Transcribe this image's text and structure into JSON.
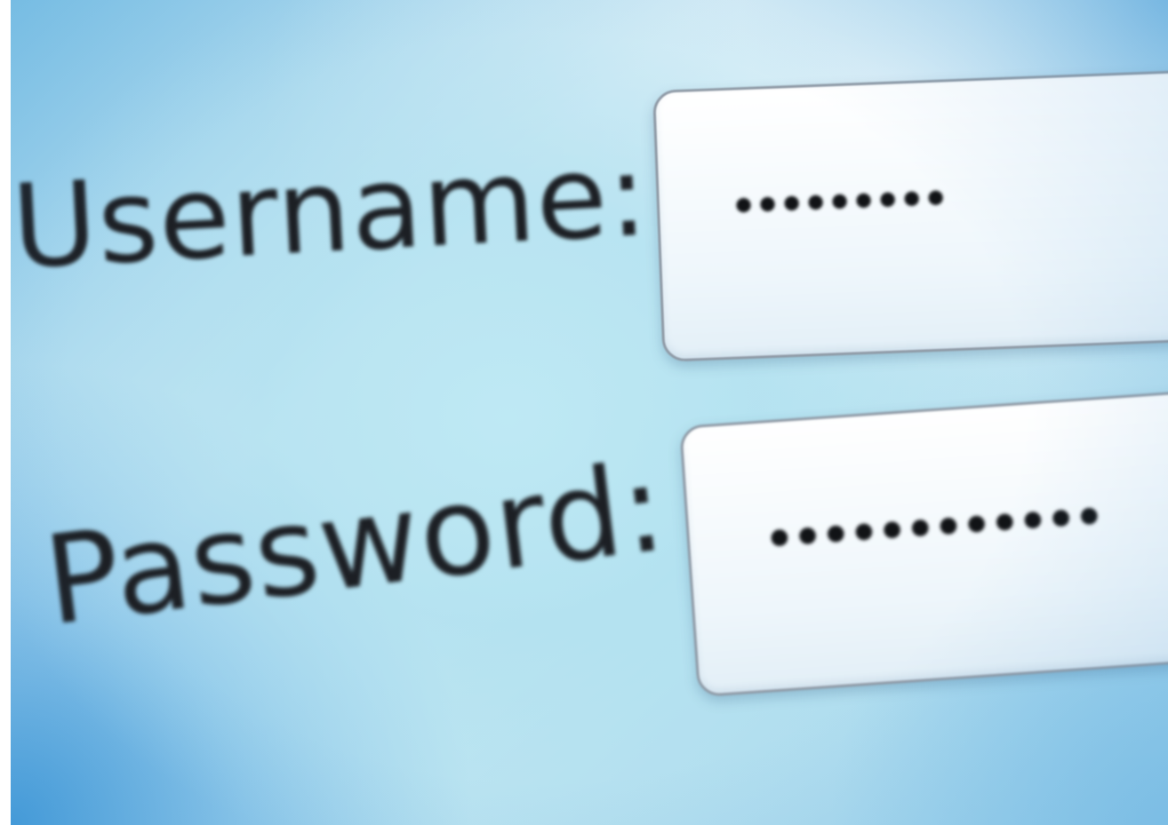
{
  "login_form": {
    "username": {
      "label": "Username:",
      "masked_value": "•••••••••",
      "field_type": "text-input"
    },
    "password": {
      "label": "Password:",
      "masked_value": "••••••••••••",
      "field_type": "password-input"
    }
  },
  "colors": {
    "background_light": "#cfe9f4",
    "background_accent": "#3f95d2",
    "field_background": "#ffffff",
    "field_border": "#8f9aa6",
    "text": "#1c1f24"
  }
}
